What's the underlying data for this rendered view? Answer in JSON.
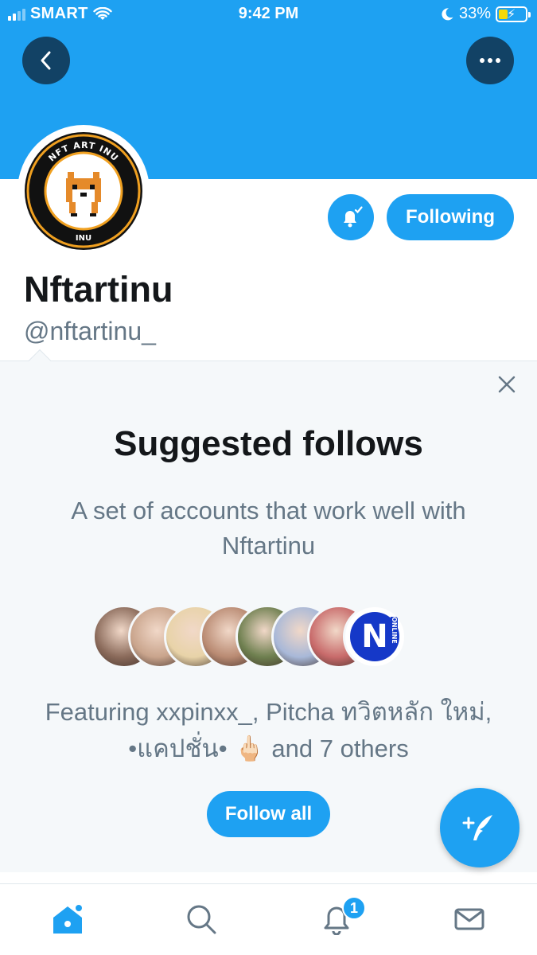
{
  "status_bar": {
    "carrier": "SMART",
    "time": "9:42 PM",
    "battery": "33%",
    "battery_level": 0.33,
    "icons": [
      "signal-icon",
      "wifi-icon",
      "moon-icon",
      "battery-charging-icon"
    ]
  },
  "header": {
    "back_icon": "chevron-left-icon",
    "more_icon": "more-horizontal-icon",
    "banner_color": "#1ea1f2"
  },
  "profile": {
    "avatar_text": "NFT ART INU",
    "avatar_text_bottom": "INU",
    "display_name": "Nftartinu",
    "handle": "@nftartinu_",
    "following_label": "Following",
    "bell_icon": "bell-check-icon"
  },
  "suggested": {
    "title": "Suggested follows",
    "description": "A set of accounts that work well with Nftartinu",
    "featuring": "Featuring xxpinxx_, Pitcha ทวิตหลัก ใหม่, •แคปชั่น• 🖕🏻 and 7 others",
    "follow_all_label": "Follow all",
    "avatar_colors": [
      "#8a6a5a",
      "#c9a48c",
      "#e8d3a8",
      "#b98a72",
      "#6e7f4f",
      "#a8b8d8",
      "#c86a6a",
      "#1538c8"
    ],
    "last_avatar_text": "ONLINE"
  },
  "fab": {
    "icon": "compose-tweet-icon",
    "label": "+"
  },
  "tabbar": {
    "items": [
      "home-icon",
      "search-icon",
      "notifications-icon",
      "messages-icon"
    ],
    "notifications_badge": "1",
    "accent": "#1ea1f2"
  }
}
